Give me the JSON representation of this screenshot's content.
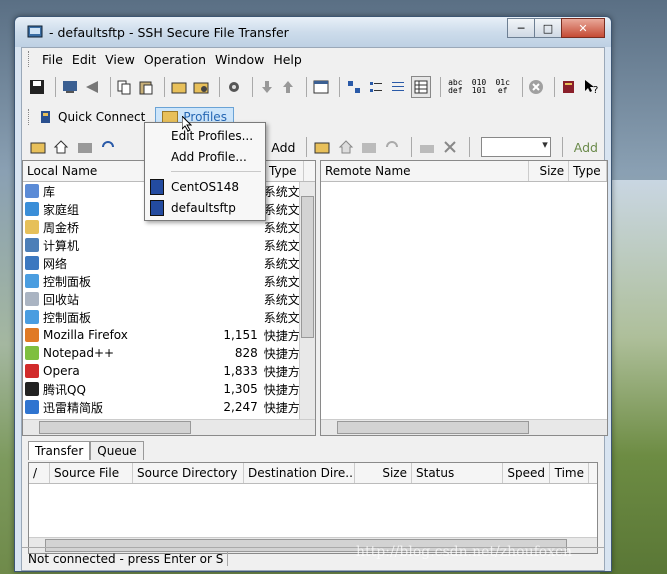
{
  "window": {
    "title": "- defaultsftp - SSH Secure File Transfer",
    "min_label": "─",
    "max_label": "□",
    "close_label": "✕"
  },
  "menu": [
    "File",
    "Edit",
    "View",
    "Operation",
    "Window",
    "Help"
  ],
  "toolbar": {
    "glyphs": [
      "abc def",
      "010 101",
      "01c ef"
    ]
  },
  "quickbar": {
    "quick_connect": "Quick Connect",
    "profiles": "Profiles"
  },
  "subbar": {
    "add_left": "Add",
    "add_right": "Add"
  },
  "local": {
    "headers": {
      "name": "Local Name",
      "type": "Type"
    },
    "rows": [
      {
        "name": "库",
        "size": "",
        "type": "系统文",
        "icon_color": "#5b8bd6"
      },
      {
        "name": "家庭组",
        "size": "",
        "type": "系统文",
        "icon_color": "#3a8ed8"
      },
      {
        "name": "周金桥",
        "size": "",
        "type": "系统文",
        "icon_color": "#e6c05a"
      },
      {
        "name": "计算机",
        "size": "",
        "type": "系统文",
        "icon_color": "#4d7fb8"
      },
      {
        "name": "网络",
        "size": "",
        "type": "系统文",
        "icon_color": "#3c78c0"
      },
      {
        "name": "控制面板",
        "size": "",
        "type": "系统文",
        "icon_color": "#4a9de0"
      },
      {
        "name": "回收站",
        "size": "",
        "type": "系统文",
        "icon_color": "#aab4c2"
      },
      {
        "name": "控制面板",
        "size": "",
        "type": "系统文",
        "icon_color": "#4a9de0"
      },
      {
        "name": "Mozilla Firefox",
        "size": "1,151",
        "type": "快捷方",
        "icon_color": "#e07a25"
      },
      {
        "name": "Notepad++",
        "size": "828",
        "type": "快捷方",
        "icon_color": "#7fbf3f"
      },
      {
        "name": "Opera",
        "size": "1,833",
        "type": "快捷方",
        "icon_color": "#d12b2b"
      },
      {
        "name": "腾讯QQ",
        "size": "1,305",
        "type": "快捷方",
        "icon_color": "#222222"
      },
      {
        "name": "迅雷精简版",
        "size": "2,247",
        "type": "快捷方",
        "icon_color": "#2f74d0"
      }
    ]
  },
  "remote": {
    "headers": {
      "name": "Remote Name",
      "size": "Size",
      "type": "Type"
    }
  },
  "transfer": {
    "tabs": [
      "Transfer",
      "Queue"
    ],
    "headers": [
      "/",
      "Source File",
      "Source Directory",
      "Destination Dire...",
      "Size",
      "Status",
      "Speed",
      "Time"
    ]
  },
  "status": {
    "text": "Not connected - press Enter or S"
  },
  "dropdown": {
    "items": [
      "Edit Profiles...",
      "Add Profile..."
    ],
    "profiles": [
      "CentOS148",
      "defaultsftp"
    ]
  },
  "watermark": "http://blog.csdn.net/zhoufoxcn"
}
